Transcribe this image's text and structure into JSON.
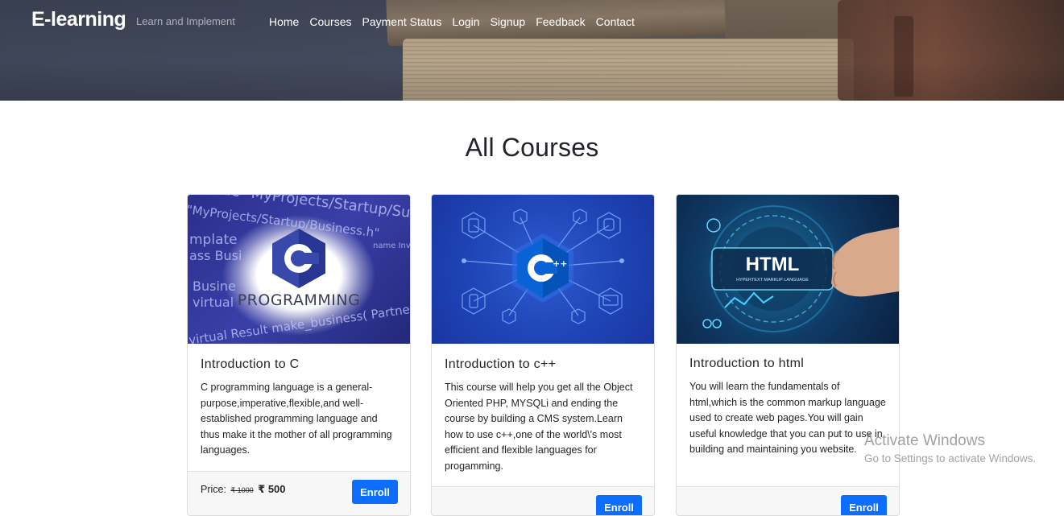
{
  "header": {
    "brand": "E-learning",
    "tagline": "Learn and Implement",
    "nav": [
      "Home",
      "Courses",
      "Payment Status",
      "Login",
      "Signup",
      "Feedback",
      "Contact"
    ]
  },
  "main": {
    "title": "All Courses",
    "courses": [
      {
        "image_text": "PROGRAMMING",
        "image_letter": "C",
        "title": "Introduction to C",
        "description": "C programming language is a general-purpose,imperative,flexible,and well-established programming language and thus make it the mother of all programming languages.",
        "price_label": "Price:",
        "old_price": "₹ 1000",
        "new_price": "₹ 500",
        "enroll_label": "Enroll"
      },
      {
        "image_letter": "C",
        "image_plus": "++",
        "title": "Introduction to c++",
        "description": "This course will help you get all the Object Oriented PHP, MYSQLi and ending the course by building a CMS system.Learn how to use c++,one of the world\\'s most efficient and flexible languages for progamming.",
        "enroll_label": "Enroll"
      },
      {
        "image_text": "HTML",
        "image_subtext": "HYPERTEXT MARKUP LANGUAGE",
        "title": "Introduction to html",
        "description": "You will learn the fundamentals of html,which is the common markup language used to create web pages.You will gain useful knowledge that you can put to use in building and maintaining you website.",
        "enroll_label": "Enroll"
      }
    ]
  },
  "watermark": {
    "title": "Activate Windows",
    "subtitle": "Go to Settings to activate Windows."
  },
  "colors": {
    "primary": "#0d6efd",
    "hero": "#444a5d"
  }
}
